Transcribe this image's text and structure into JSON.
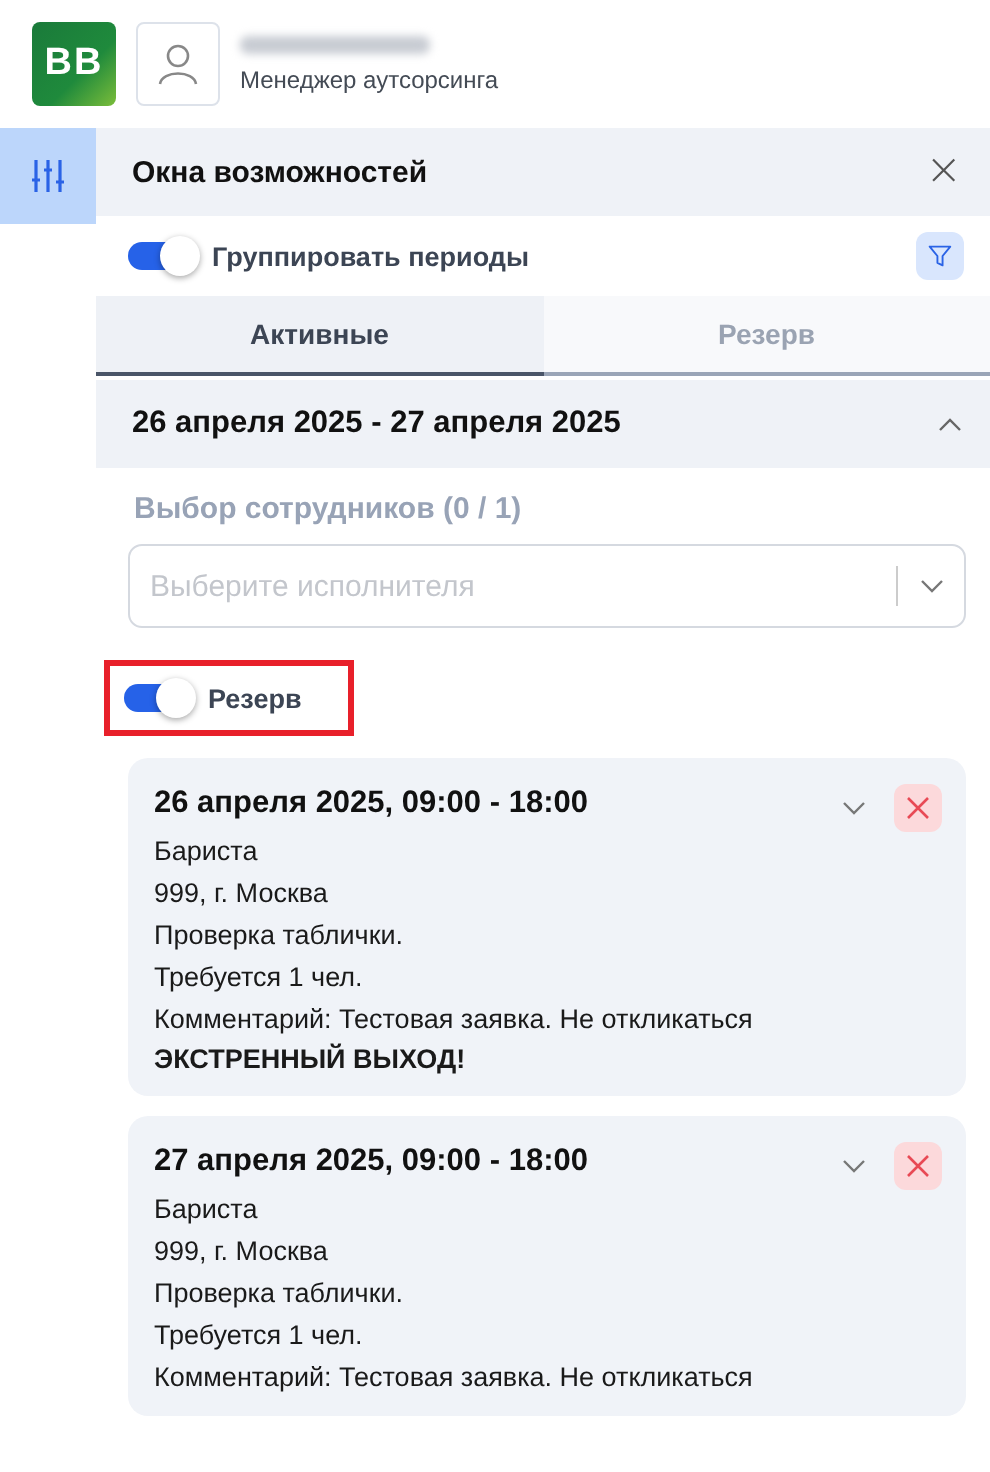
{
  "header": {
    "logo": "BB",
    "role": "Менеджер аутсорсинга"
  },
  "sidebar": {
    "items": [
      {
        "selected": true
      }
    ]
  },
  "panel": {
    "title": "Окна возможностей",
    "close": "×",
    "group_toggle": {
      "label": "Группировать периоды",
      "on": true
    },
    "tabs": [
      {
        "label": "Активные",
        "selected": true
      },
      {
        "label": "Резерв",
        "selected": false
      }
    ],
    "group": {
      "title": "26 апреля 2025 - 27 апреля 2025",
      "expanded": true,
      "staff_label": "Выбор сотрудников (0 / 1)",
      "select": {
        "placeholder": "Выберите исполнителя"
      },
      "reserve_toggle": {
        "label": "Резерв",
        "on": true,
        "highlighted": true
      },
      "cards": [
        {
          "title": "26 апреля 2025, 09:00 - 18:00",
          "lines": [
            {
              "kind": "text",
              "text": "Бариста"
            },
            {
              "kind": "text",
              "text": "999, г. Москва"
            },
            {
              "kind": "text",
              "text": "Проверка таблички."
            },
            {
              "kind": "text",
              "text": "Требуется 1 чел."
            },
            {
              "kind": "text",
              "text": "Комментарий: Тестовая заявка. Не откликаться"
            },
            {
              "kind": "alert",
              "text": "ЭКСТРЕННЫЙ ВЫХОД!"
            }
          ]
        },
        {
          "title": "27 апреля 2025, 09:00 - 18:00",
          "lines": [
            {
              "kind": "text",
              "text": "Бариста"
            },
            {
              "kind": "text",
              "text": "999, г. Москва"
            },
            {
              "kind": "text",
              "text": "Проверка таблички."
            },
            {
              "kind": "text",
              "text": "Требуется 1 чел."
            },
            {
              "kind": "text",
              "text": "Комментарий: Тестовая заявка. Не откликаться"
            }
          ]
        }
      ]
    }
  }
}
